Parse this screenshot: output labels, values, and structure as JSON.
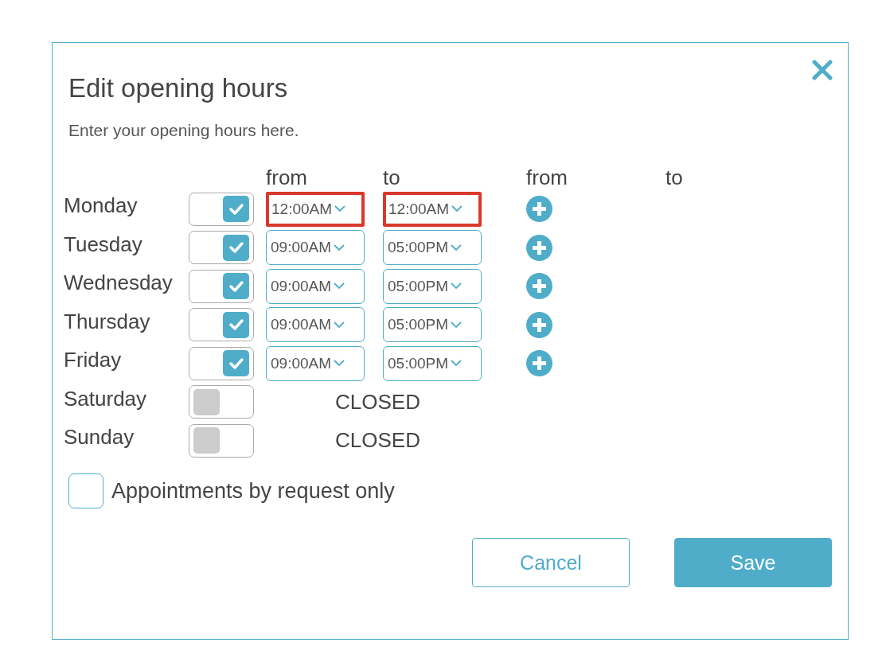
{
  "dialog": {
    "title": "Edit opening hours",
    "subtitle": "Enter your opening hours here."
  },
  "headers": [
    "from",
    "to",
    "from",
    "to"
  ],
  "days": [
    {
      "name": "Monday",
      "open": true,
      "from": "12:00AM",
      "to": "12:00AM",
      "highlighted": true
    },
    {
      "name": "Tuesday",
      "open": true,
      "from": "09:00AM",
      "to": "05:00PM",
      "highlighted": false
    },
    {
      "name": "Wednesday",
      "open": true,
      "from": "09:00AM",
      "to": "05:00PM",
      "highlighted": false
    },
    {
      "name": "Thursday",
      "open": true,
      "from": "09:00AM",
      "to": "05:00PM",
      "highlighted": false
    },
    {
      "name": "Friday",
      "open": true,
      "from": "09:00AM",
      "to": "05:00PM",
      "highlighted": false
    },
    {
      "name": "Saturday",
      "open": false,
      "status": "CLOSED"
    },
    {
      "name": "Sunday",
      "open": false,
      "status": "CLOSED"
    }
  ],
  "appointments": {
    "label": "Appointments by request only",
    "checked": false
  },
  "buttons": [
    {
      "kind": "secondary",
      "label": "Cancel"
    },
    {
      "kind": "primary",
      "label": "Save"
    }
  ]
}
